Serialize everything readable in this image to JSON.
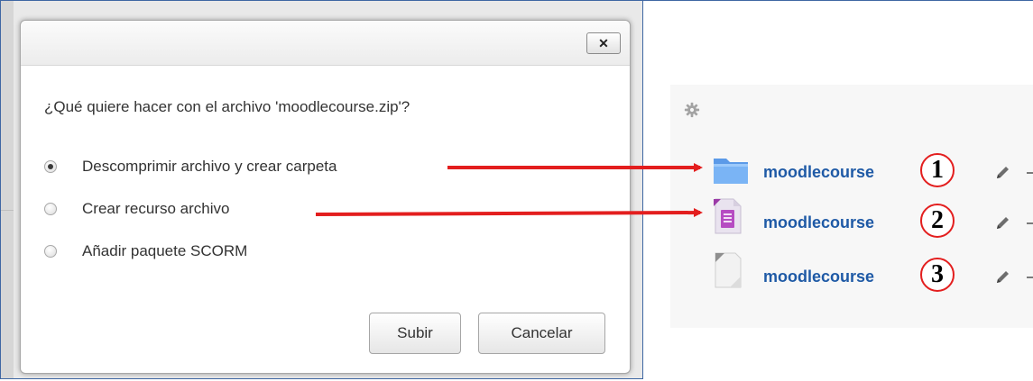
{
  "dialog": {
    "close_label": "✕",
    "question": "¿Qué quiere hacer con el archivo 'moodlecourse.zip'?",
    "options": [
      {
        "label": "Descomprimir archivo y crear carpeta",
        "checked": true
      },
      {
        "label": "Crear recurso archivo",
        "checked": false
      },
      {
        "label": "Añadir paquete SCORM",
        "checked": false
      }
    ],
    "upload_label": "Subir",
    "cancel_label": "Cancelar"
  },
  "course": {
    "items": [
      {
        "name": "moodlecourse",
        "number": "1",
        "icon": "folder-icon"
      },
      {
        "name": "moodlecourse",
        "number": "2",
        "icon": "file-resource-icon"
      },
      {
        "name": "moodlecourse",
        "number": "3",
        "icon": "scorm-package-icon"
      }
    ]
  },
  "colors": {
    "arrow": "#e31e1e",
    "link": "#1f5aa6",
    "frame_border": "#3f67a3"
  }
}
